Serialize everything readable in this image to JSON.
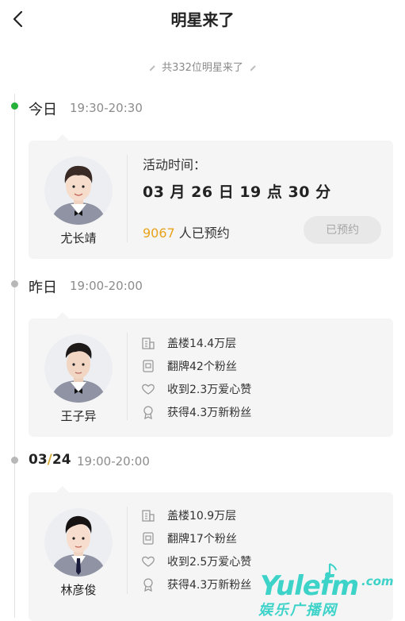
{
  "header": {
    "title": "明星来了",
    "back_icon": "chevron-left-icon"
  },
  "summary": {
    "count_text": "共332位明星来了"
  },
  "colors": {
    "active_dot": "#25b13a",
    "inactive_dot": "#b8b8b8",
    "reserve_count": "#e8a31b",
    "watermark": "#3ed3c9"
  },
  "days": [
    {
      "label": "今日",
      "time": "19:30-20:30",
      "active": true,
      "star": {
        "name": "尤长靖",
        "activity_label": "活动时间：",
        "activity_time": "03 月 26 日 19 点 30 分",
        "reserve_number": "9067",
        "reserve_suffix": " 人已预约",
        "reserve_button": "已预约"
      }
    },
    {
      "label": "昨日",
      "time": "19:00-20:00",
      "active": false,
      "star": {
        "name": "王子异",
        "stats": [
          {
            "icon": "building-icon",
            "text": "盖楼14.4万层"
          },
          {
            "icon": "card-icon",
            "text": "翻牌42个粉丝"
          },
          {
            "icon": "heart-icon",
            "text": "收到2.3万爱心赞"
          },
          {
            "icon": "badge-icon",
            "text": "获得4.3万新粉丝"
          }
        ]
      }
    },
    {
      "label_month": "03",
      "label_sep": "/",
      "label_day": "24",
      "time": "19:00-20:00",
      "active": false,
      "star": {
        "name": "林彦俊",
        "stats": [
          {
            "icon": "building-icon",
            "text": "盖楼10.9万层"
          },
          {
            "icon": "card-icon",
            "text": "翻牌17个粉丝"
          },
          {
            "icon": "heart-icon",
            "text": "收到2.5万爱心赞"
          },
          {
            "icon": "badge-icon",
            "text": "获得4.3万新粉丝"
          }
        ]
      }
    }
  ],
  "watermark": {
    "brand": "Yulefm",
    "domain": ".com",
    "chinese": "娱乐广播网"
  }
}
